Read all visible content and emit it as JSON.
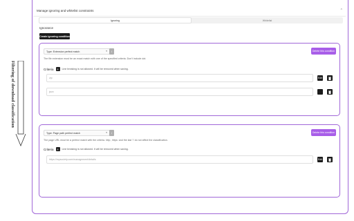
{
  "annotation": {
    "side_text": "Filtering of download classification"
  },
  "header": {
    "title": "Manage ignoring and whitelist constraints",
    "chevron": "^"
  },
  "tabs": [
    {
      "label": "Ignoring",
      "active": true
    },
    {
      "label": "Whitelist",
      "active": false
    }
  ],
  "section": {
    "title": "Ignorance",
    "create_label": "Create ignoring condition"
  },
  "cards": [
    {
      "type_value": "Type: Extension perfect match",
      "info_label": "i",
      "delete_label": "Delete this condition",
      "description": "The file extension must be an exact match with one of the specified criteria. Don't include dot.",
      "criteria_label": "Criteria",
      "plus_label": "+",
      "criteria_note": "Line breaking is not allowed. It will be removed when saving.",
      "criteria": [
        {
          "value": "zip",
          "edit_label": "Edit"
        },
        {
          "value": "json",
          "edit_label": ""
        }
      ]
    },
    {
      "type_value": "Type: Page path perfect match",
      "info_label": "i",
      "delete_label": "Delete this condition",
      "description": "The page URL must be a perfect match with the criteria. http:, https: and the last '/' do not affect the classification.",
      "criteria_label": "Criteria",
      "plus_label": "+",
      "criteria_note": "Line breaking is not allowed. It will be removed when saving.",
      "criteria": [
        {
          "value": "https://mysociety.com/management/details",
          "edit_label": "Edit"
        }
      ]
    }
  ],
  "colors": {
    "accent": "#a066d8",
    "delete_button": "#a85ee8",
    "dark_button": "#1c1c1c"
  }
}
